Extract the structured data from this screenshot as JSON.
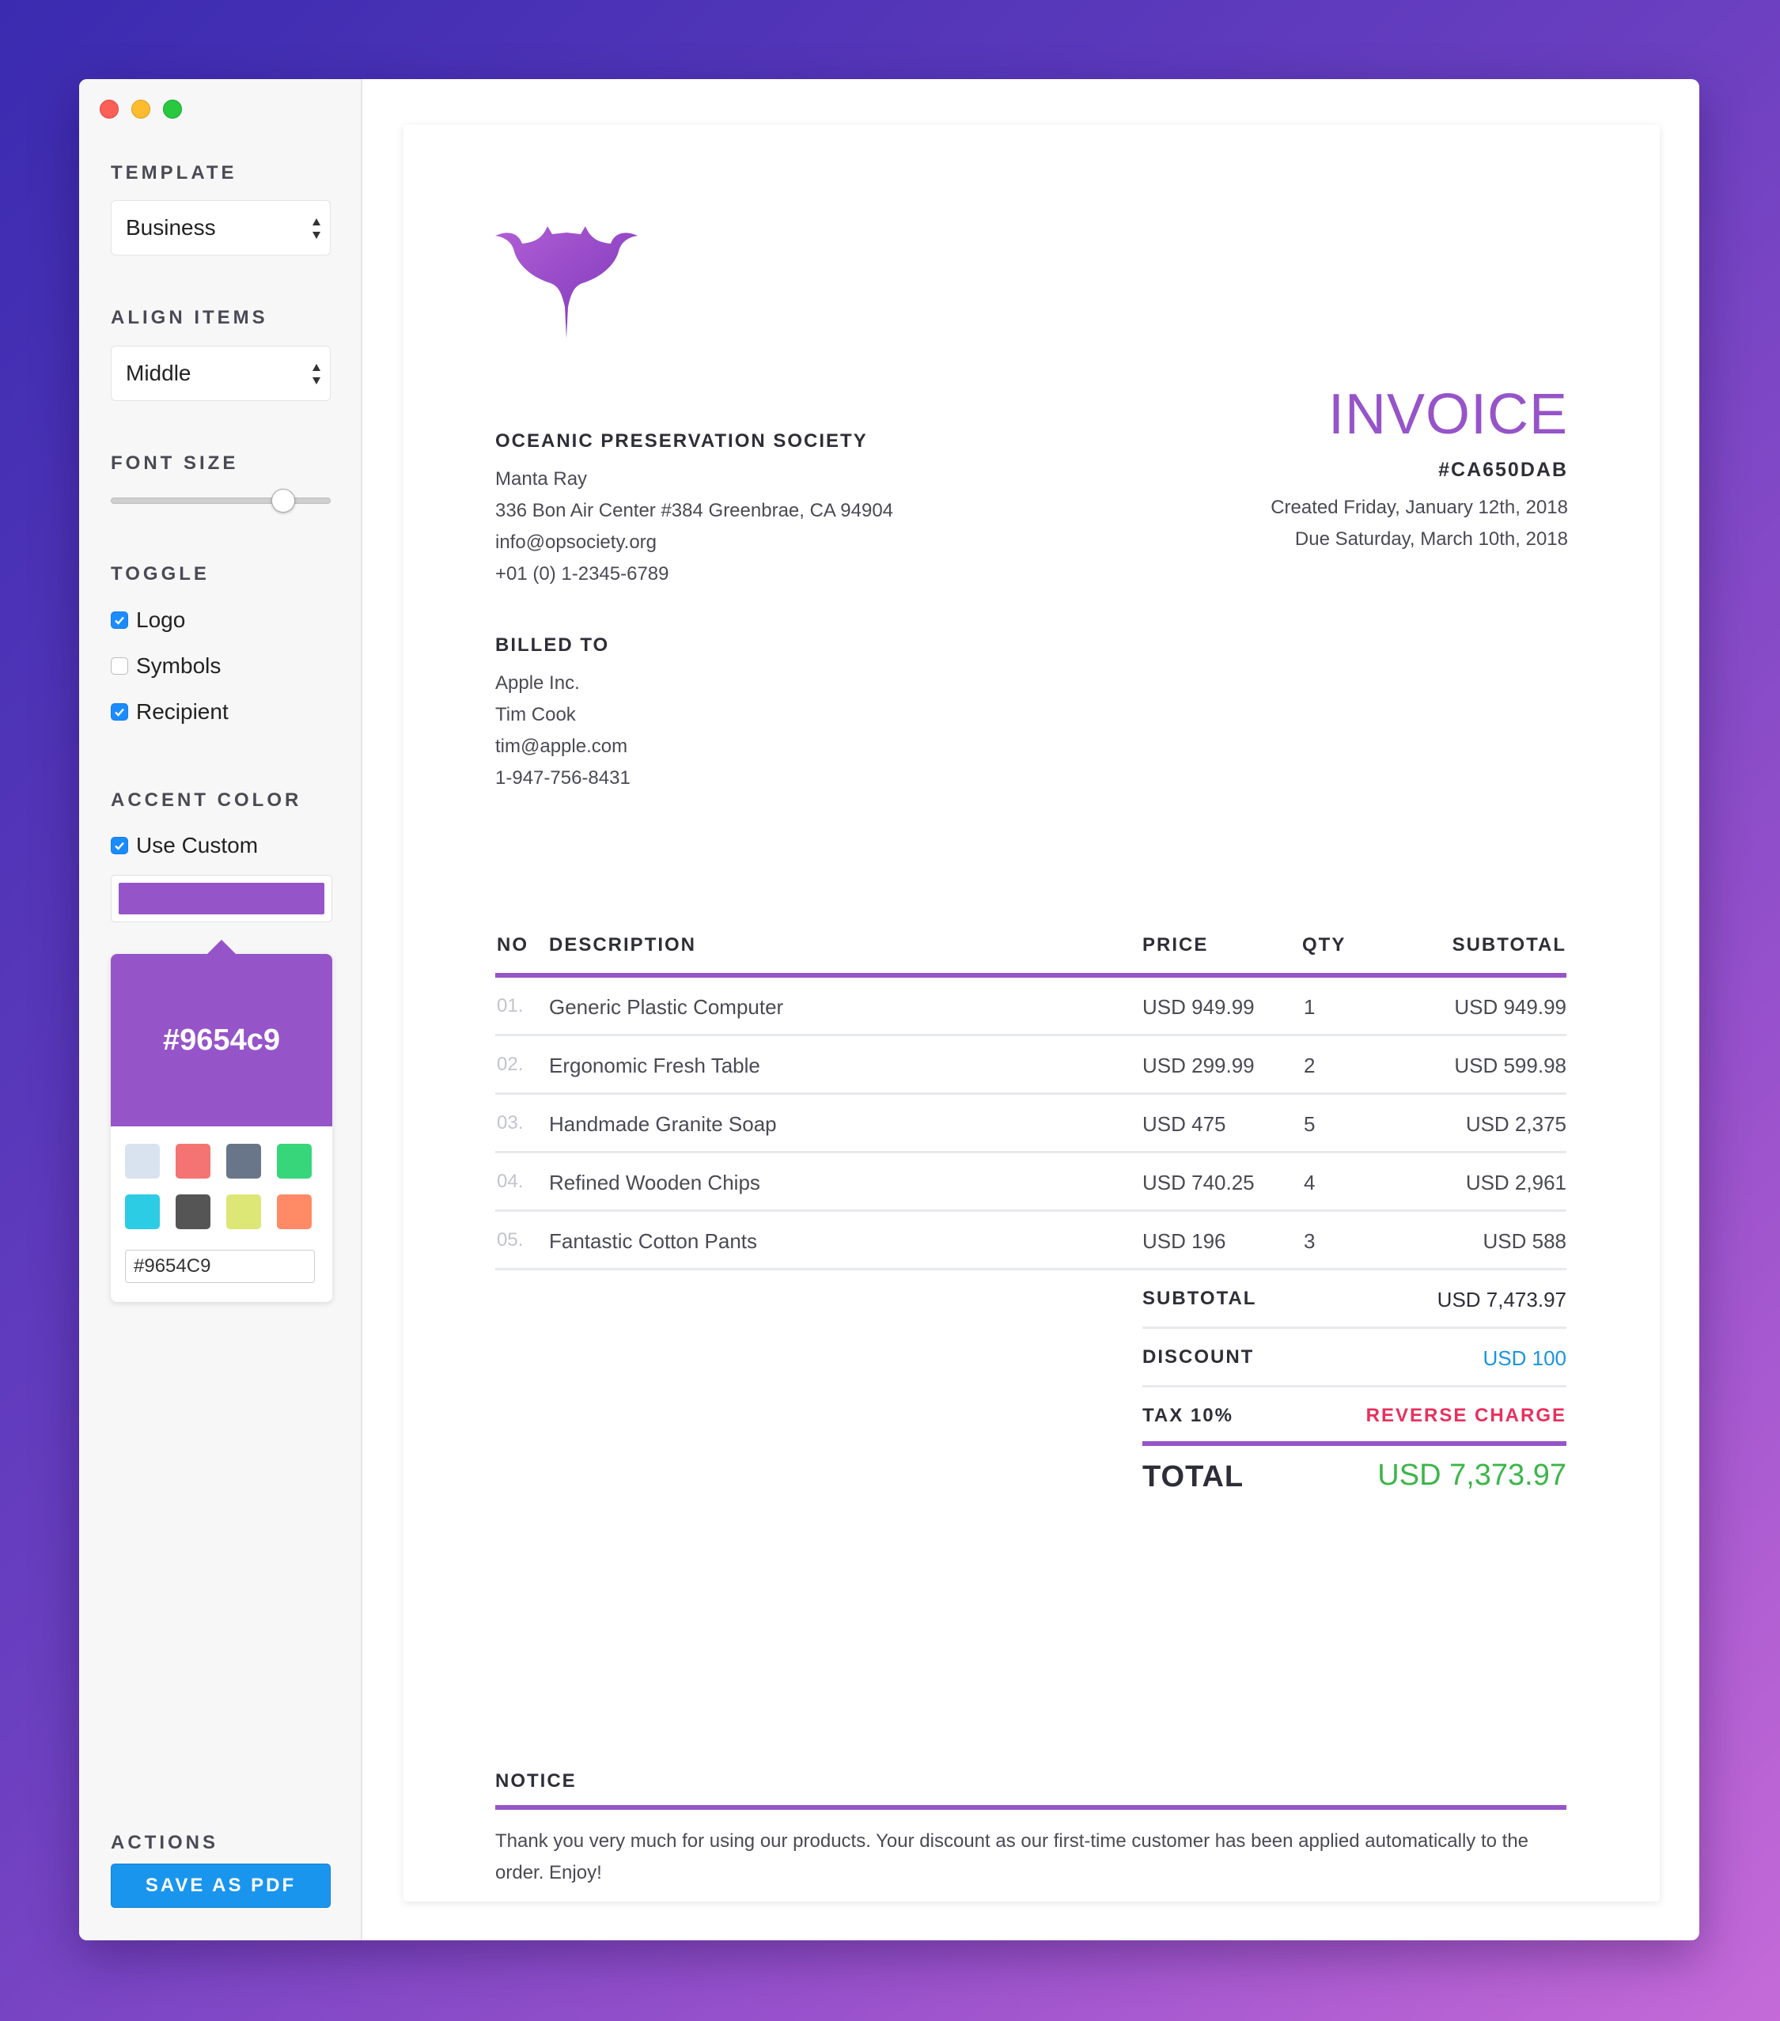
{
  "sidebar": {
    "template": {
      "label": "TEMPLATE",
      "value": "Business"
    },
    "align_items": {
      "label": "ALIGN ITEMS",
      "value": "Middle"
    },
    "font_size": {
      "label": "FONT SIZE",
      "level": 0.82
    },
    "toggle": {
      "label": "TOGGLE",
      "items": [
        {
          "label": "Logo",
          "checked": true
        },
        {
          "label": "Symbols",
          "checked": false
        },
        {
          "label": "Recipient",
          "checked": true
        }
      ]
    },
    "accent": {
      "label": "ACCENT COLOR",
      "use_custom_label": "Use Custom",
      "use_custom_checked": true,
      "color": "#9654c9",
      "color_display": "#9654c9",
      "hex_input": "#9654C9",
      "swatches": [
        "#d9e3f0",
        "#f47373",
        "#697689",
        "#37d67a",
        "#2ccce4",
        "#555555",
        "#dce775",
        "#ff8a65"
      ]
    },
    "actions": {
      "label": "ACTIONS",
      "save_label": "SAVE AS PDF"
    }
  },
  "invoice": {
    "org": {
      "name": "OCEANIC PRESERVATION SOCIETY",
      "lines": [
        "Manta Ray",
        "336 Bon Air Center #384 Greenbrae, CA 94904",
        "info@opsociety.org",
        "+01 (0) 1-2345-6789"
      ]
    },
    "title": "INVOICE",
    "number": "#CA650DAB",
    "created": "Created Friday, January 12th, 2018",
    "due": "Due Saturday, March 10th, 2018",
    "billed_to": {
      "label": "BILLED TO",
      "lines": [
        "Apple Inc.",
        "Tim Cook",
        "tim@apple.com",
        "1-947-756-8431"
      ]
    },
    "table": {
      "headers": {
        "no": "NO",
        "description": "DESCRIPTION",
        "price": "PRICE",
        "qty": "QTY",
        "subtotal": "SUBTOTAL"
      },
      "rows": [
        {
          "no": "01.",
          "description": "Generic Plastic Computer",
          "price": "USD 949.99",
          "qty": "1",
          "subtotal": "USD 949.99"
        },
        {
          "no": "02.",
          "description": "Ergonomic Fresh Table",
          "price": "USD 299.99",
          "qty": "2",
          "subtotal": "USD 599.98"
        },
        {
          "no": "03.",
          "description": "Handmade Granite Soap",
          "price": "USD 475",
          "qty": "5",
          "subtotal": "USD 2,375"
        },
        {
          "no": "04.",
          "description": "Refined Wooden Chips",
          "price": "USD 740.25",
          "qty": "4",
          "subtotal": "USD 2,961"
        },
        {
          "no": "05.",
          "description": "Fantastic Cotton Pants",
          "price": "USD 196",
          "qty": "3",
          "subtotal": "USD 588"
        }
      ]
    },
    "summary": {
      "subtotal_label": "SUBTOTAL",
      "subtotal_value": "USD 7,473.97",
      "discount_label": "DISCOUNT",
      "discount_value": "USD 100",
      "tax_label": "TAX 10%",
      "tax_value": "REVERSE CHARGE",
      "total_label": "TOTAL",
      "total_value": "USD 7,373.97"
    },
    "notice": {
      "label": "NOTICE",
      "text": "Thank you very much for using our products. Your discount as our first-time customer has been applied automatically to the order. Enjoy!"
    }
  },
  "colors": {
    "accent": "#9654c9",
    "discount": "#1a95e0",
    "tax": "#e8305c",
    "total": "#3db54a",
    "button": "#1a95ee"
  }
}
